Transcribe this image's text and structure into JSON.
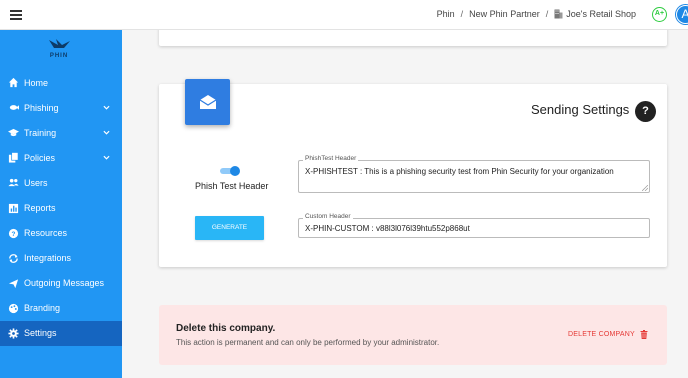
{
  "header": {
    "breadcrumb": [
      "Phin",
      "New Phin Partner",
      "Joe's Retail Shop"
    ],
    "separator": "/",
    "grade_badge": "A+",
    "avatar_letter": "A"
  },
  "sidebar": {
    "logo_text": "PHIN",
    "items": [
      {
        "label": "Home",
        "icon": "home-icon",
        "expandable": false
      },
      {
        "label": "Phishing",
        "icon": "fish-icon",
        "expandable": true
      },
      {
        "label": "Training",
        "icon": "graduation-cap-icon",
        "expandable": true
      },
      {
        "label": "Policies",
        "icon": "documents-icon",
        "expandable": true
      },
      {
        "label": "Users",
        "icon": "users-icon",
        "expandable": false
      },
      {
        "label": "Reports",
        "icon": "bar-chart-icon",
        "expandable": false
      },
      {
        "label": "Resources",
        "icon": "help-circle-icon",
        "expandable": false
      },
      {
        "label": "Integrations",
        "icon": "sync-icon",
        "expandable": false
      },
      {
        "label": "Outgoing Messages",
        "icon": "paper-plane-icon",
        "expandable": false
      },
      {
        "label": "Branding",
        "icon": "palette-icon",
        "expandable": false
      },
      {
        "label": "Settings",
        "icon": "gear-icon",
        "expandable": false,
        "active": true
      }
    ]
  },
  "sending_settings": {
    "title": "Sending Settings",
    "help_label": "?",
    "toggle_label": "Phish Test Header",
    "toggle_on": true,
    "phishtest_header": {
      "label": "PhishTest Header",
      "value": "X-PHISHTEST : This is a phishing security test from Phin Security for your organization"
    },
    "generate_button": "GENERATE",
    "custom_header": {
      "label": "Custom Header",
      "value": "X-PHIN-CUSTOM : v88l3l076l39htu552p868ut"
    }
  },
  "danger_zone": {
    "title": "Delete this company.",
    "description": "This action is permanent and can only be performed by your administrator.",
    "delete_button": "DELETE COMPANY"
  },
  "colors": {
    "sidebar": "#2196f3",
    "sidebar_active": "#1565c0",
    "accent": "#2f7de1",
    "generate": "#29b6f6",
    "danger_bg": "#fde6e6",
    "danger_text": "#e53935"
  }
}
